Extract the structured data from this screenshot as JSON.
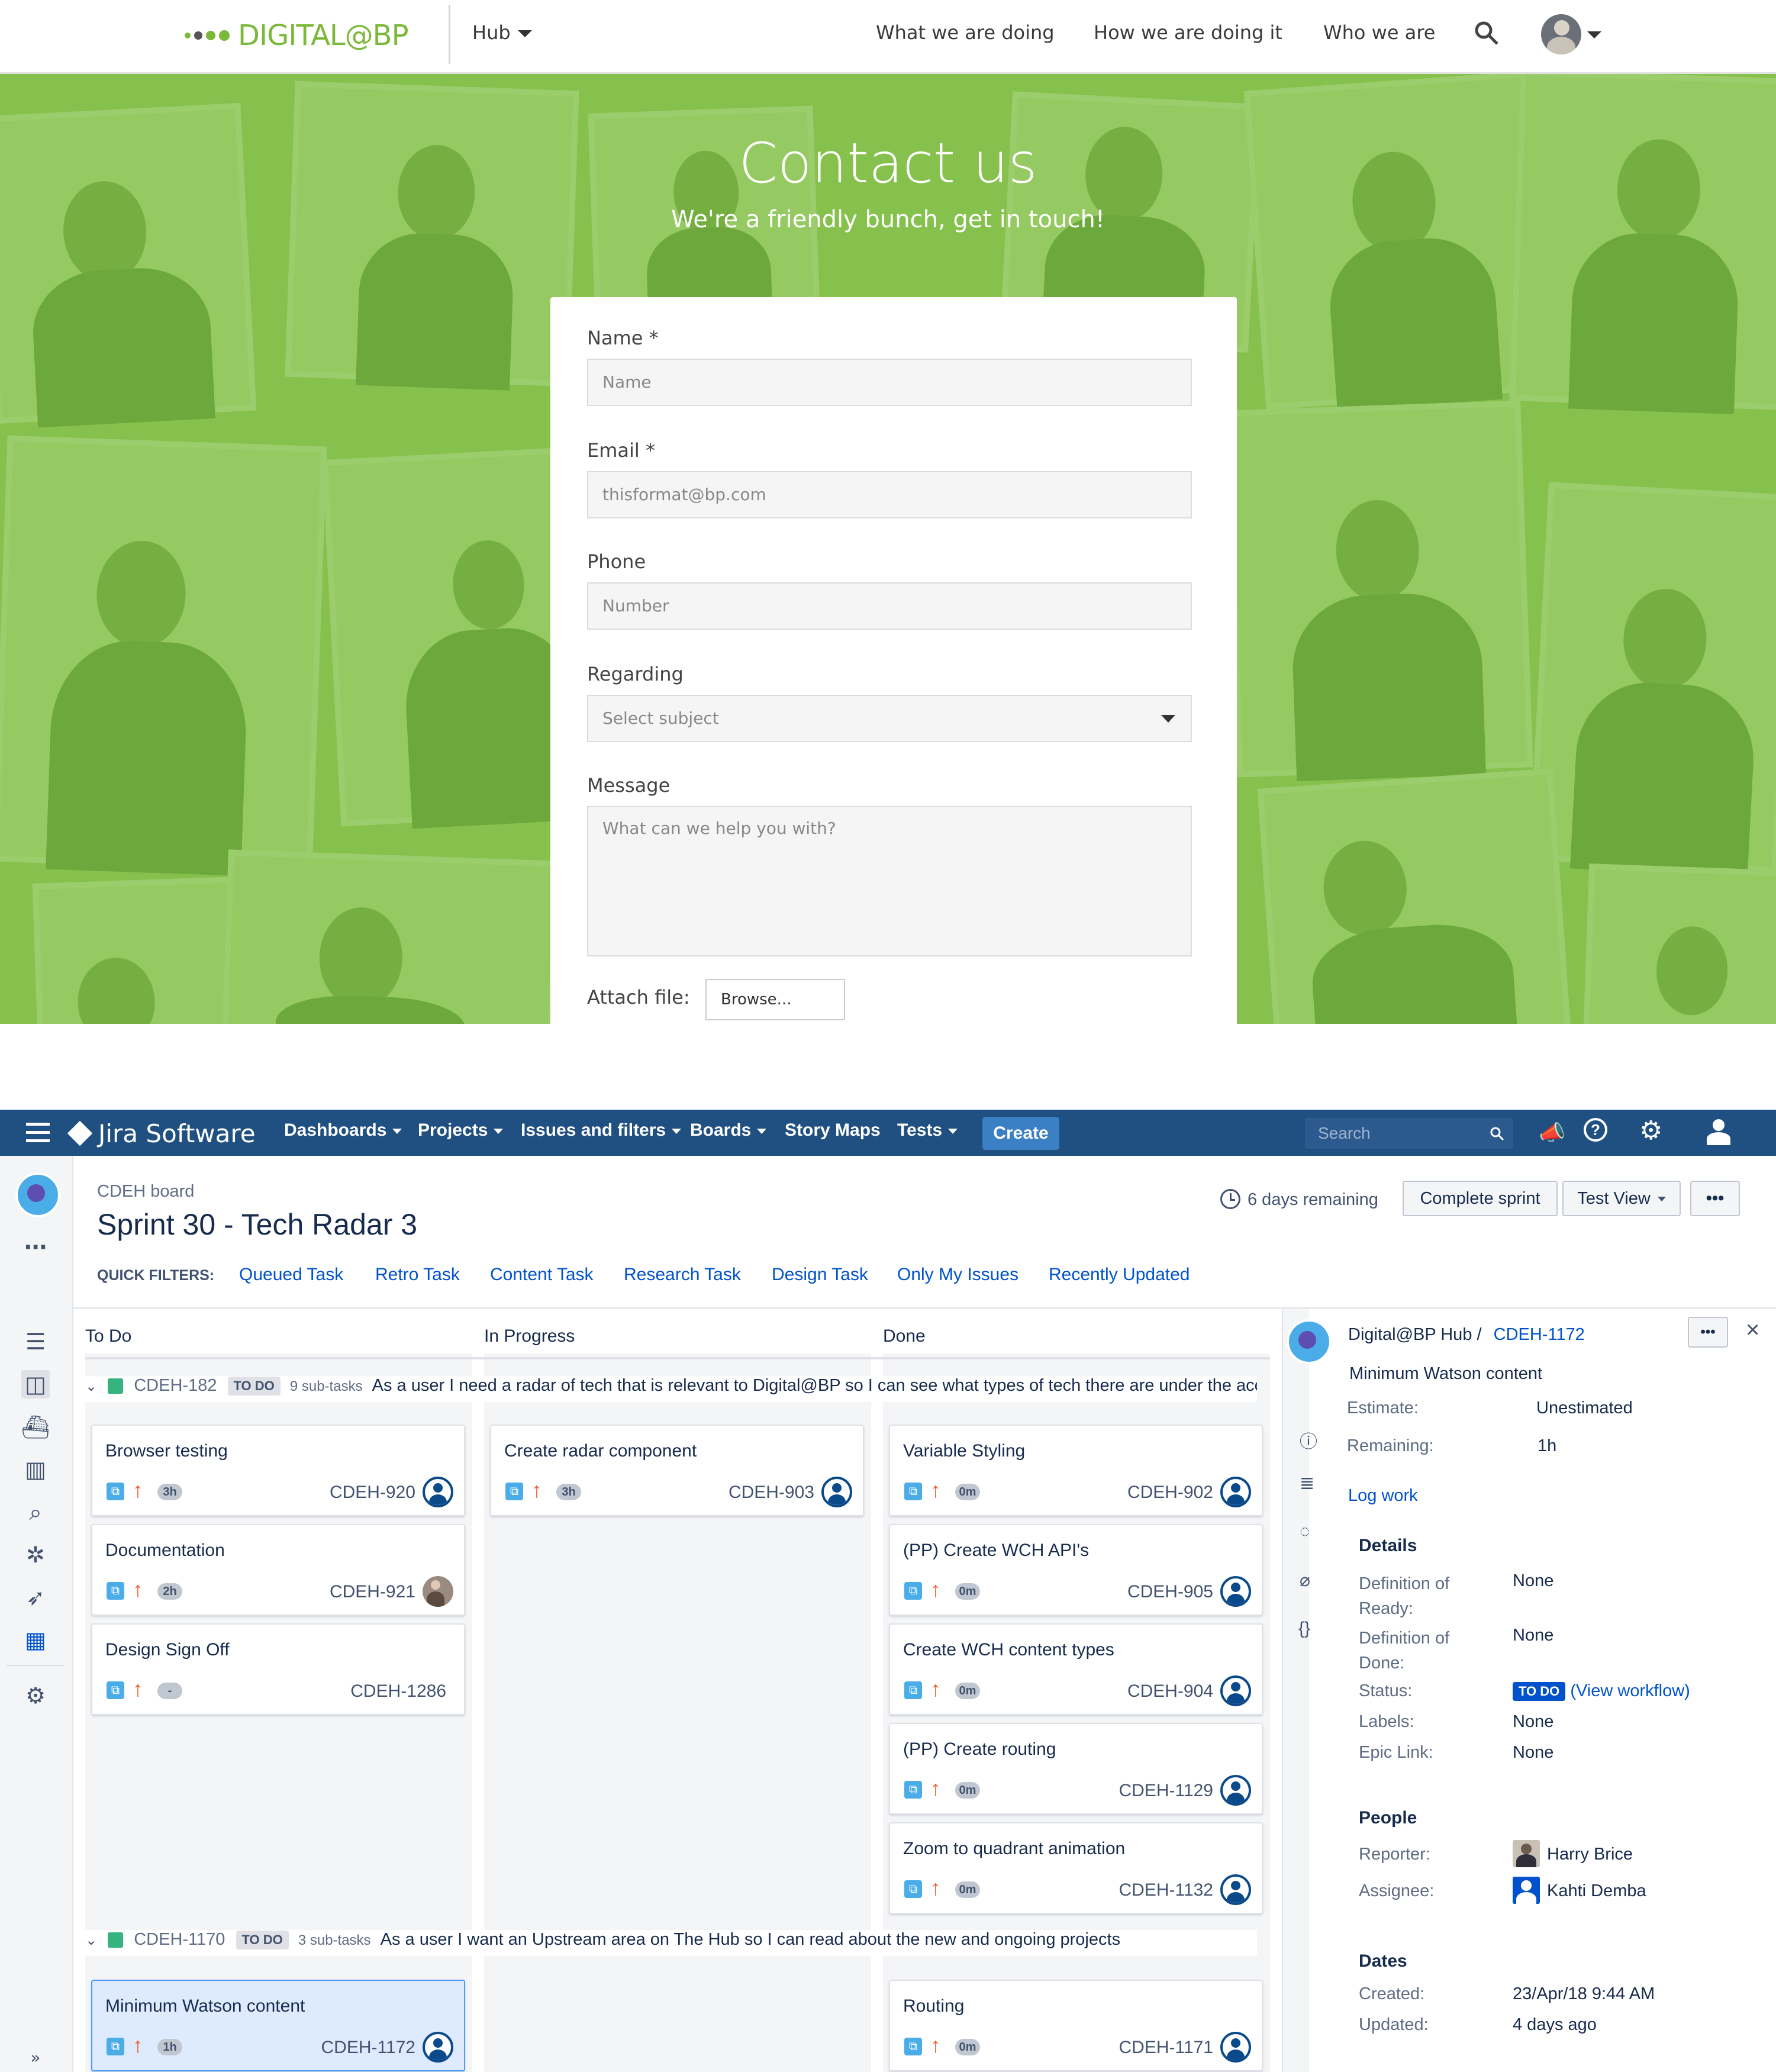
{
  "bp": {
    "logo_text": "DIGITAL@BP",
    "hub_label": "Hub",
    "nav": [
      "What we are doing",
      "How we are doing it",
      "Who we are"
    ],
    "title": "Contact us",
    "subtitle": "We're a friendly bunch, get in touch!",
    "form": {
      "name_label": "Name *",
      "name_placeholder": "Name",
      "email_label": "Email *",
      "email_placeholder": "thisformat@bp.com",
      "phone_label": "Phone",
      "phone_placeholder": "Number",
      "regarding_label": "Regarding",
      "regarding_value": "Select subject",
      "message_label": "Message",
      "message_placeholder": "What can we help you with?",
      "attach_label": "Attach file:",
      "browse_label": "Browse..."
    },
    "colors": {
      "brand_green": "#7cb83a",
      "hero_green": "#86c14f"
    }
  },
  "jira": {
    "product": "Jira Software",
    "nav": [
      "Dashboards",
      "Projects",
      "Issues and filters",
      "Boards",
      "Story Maps",
      "Tests"
    ],
    "create_label": "Create",
    "search_placeholder": "Search",
    "board_name": "CDEH board",
    "sprint_title": "Sprint 30 - Tech Radar 3",
    "remaining": "6 days remaining",
    "complete_sprint": "Complete sprint",
    "view_label": "Test View",
    "more": "•••",
    "quick_filters_label": "QUICK FILTERS:",
    "quick_filters": [
      "Queued Task",
      "Retro Task",
      "Content Task",
      "Research Task",
      "Design Task",
      "Only My Issues",
      "Recently Updated"
    ],
    "columns": [
      "To Do",
      "In Progress",
      "Done"
    ],
    "swimlanes": [
      {
        "key": "CDEH-182",
        "status": "TO DO",
        "subtasks": "9 sub-tasks",
        "summary": "As a user I need a radar of tech that is relevant to Digital@BP so I can see what types of tech there are under the acc"
      },
      {
        "key": "CDEH-1170",
        "status": "TO DO",
        "subtasks": "3 sub-tasks",
        "summary": "As a user I want an Upstream area on The Hub so I can read about the new and ongoing projects"
      }
    ],
    "cards": [
      {
        "title": "Browser testing",
        "est": "3h",
        "key": "CDEH-920"
      },
      {
        "title": "Documentation",
        "est": "2h",
        "key": "CDEH-921"
      },
      {
        "title": "Design Sign Off",
        "est": "-",
        "key": "CDEH-1286"
      },
      {
        "title": "Create radar component",
        "est": "3h",
        "key": "CDEH-903"
      },
      {
        "title": "Variable Styling",
        "est": "0m",
        "key": "CDEH-902"
      },
      {
        "title": "(PP) Create WCH API's",
        "est": "0m",
        "key": "CDEH-905"
      },
      {
        "title": "Create WCH content types",
        "est": "0m",
        "key": "CDEH-904"
      },
      {
        "title": "(PP) Create routing",
        "est": "0m",
        "key": "CDEH-1129"
      },
      {
        "title": "Zoom to quadrant animation",
        "est": "0m",
        "key": "CDEH-1132"
      },
      {
        "title": "Minimum Watson content",
        "est": "1h",
        "key": "CDEH-1172"
      },
      {
        "title": "Routing",
        "est": "0m",
        "key": "CDEH-1171"
      }
    ],
    "detail": {
      "project": "Digital@BP Hub /",
      "issue_key": "CDEH-1172",
      "summary": "Minimum Watson content",
      "estimate_label": "Estimate:",
      "estimate_value": "Unestimated",
      "remaining_label": "Remaining:",
      "remaining_value": "1h",
      "log_work": "Log work",
      "details_head": "Details",
      "dor_label": "Definition of Ready:",
      "dor_value": "None",
      "dod_label": "Definition of Done:",
      "dod_value": "None",
      "status_label": "Status:",
      "status_value": "TO DO",
      "view_workflow": "(View workflow)",
      "labels_label": "Labels:",
      "labels_value": "None",
      "epic_label": "Epic Link:",
      "epic_value": "None",
      "people_head": "People",
      "reporter_label": "Reporter:",
      "reporter_value": "Harry Brice",
      "assignee_label": "Assignee:",
      "assignee_value": "Kahti Demba",
      "dates_head": "Dates",
      "created_label": "Created:",
      "created_value": "23/Apr/18 9:44 AM",
      "updated_label": "Updated:",
      "updated_value": "4 days ago"
    },
    "colors": {
      "topbar": "#205081",
      "create": "#3b7fc4",
      "link": "#0052cc",
      "priority": "#f15c2c",
      "subtask_icon": "#4bade8"
    }
  }
}
